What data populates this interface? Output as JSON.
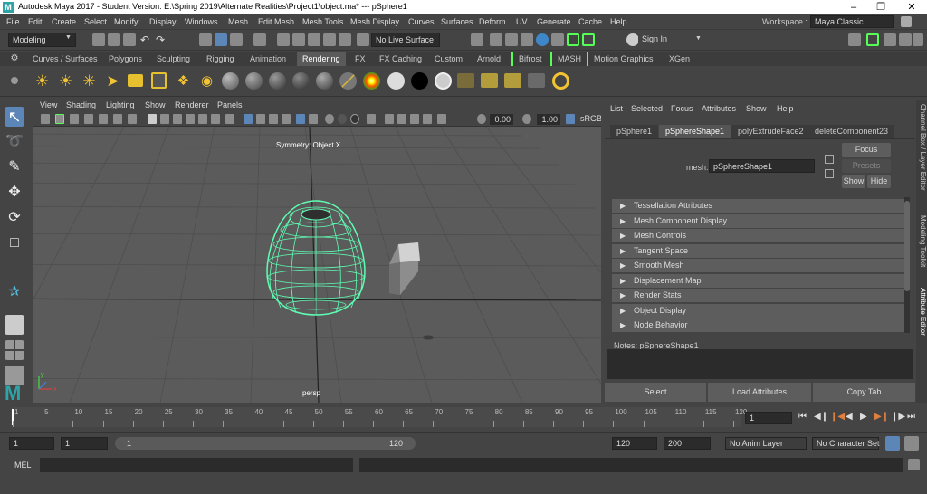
{
  "window": {
    "title": "Autodesk Maya 2017 - Student Version: E:\\Spring 2019\\Alternate Realities\\Project1\\object.ma*  ---  pSphere1",
    "logo": "M"
  },
  "menubar": [
    "File",
    "Edit",
    "Create",
    "Select",
    "Modify",
    "Display",
    "Windows",
    "Mesh",
    "Edit Mesh",
    "Mesh Tools",
    "Mesh Display",
    "Curves",
    "Surfaces",
    "Deform",
    "UV",
    "Generate",
    "Cache",
    "Help"
  ],
  "workspace": {
    "label": "Workspace :",
    "value": "Maya Classic"
  },
  "status_line": {
    "mode": "Modeling",
    "live_surface": "No Live Surface",
    "sign_in": "Sign In"
  },
  "shelf_tabs": [
    {
      "label": "Curves / Surfaces"
    },
    {
      "label": "Polygons"
    },
    {
      "label": "Sculpting"
    },
    {
      "label": "Rigging"
    },
    {
      "label": "Animation"
    },
    {
      "label": "Rendering",
      "active": true
    },
    {
      "label": "FX"
    },
    {
      "label": "FX Caching"
    },
    {
      "label": "Custom"
    },
    {
      "label": "Arnold"
    },
    {
      "label": "Bifrost"
    },
    {
      "label": "MASH"
    },
    {
      "label": "Motion Graphics"
    },
    {
      "label": "XGen"
    }
  ],
  "viewport": {
    "menus": [
      "View",
      "Shading",
      "Lighting",
      "Show",
      "Renderer",
      "Panels"
    ],
    "exposure": "0.00",
    "gamma": "1.00",
    "colorspace": "sRGB",
    "symmetry": "Symmetry: Object X",
    "camera": "persp",
    "axis_x": "x",
    "axis_y": "y",
    "accent": "#5effb4"
  },
  "attribute_editor": {
    "menus": [
      "List",
      "Selected",
      "Focus",
      "Attributes",
      "Show",
      "Help"
    ],
    "tabs": [
      {
        "label": "pSphere1"
      },
      {
        "label": "pSphereShape1",
        "active": true
      },
      {
        "label": "polyExtrudeFace2"
      },
      {
        "label": "deleteComponent23"
      }
    ],
    "mesh_label": "mesh:",
    "mesh_value": "pSphereShape1",
    "focus": "Focus",
    "presets": "Presets",
    "show": "Show",
    "hide": "Hide",
    "sections": [
      "Tessellation Attributes",
      "Mesh Component Display",
      "Mesh Controls",
      "Tangent Space",
      "Smooth Mesh",
      "Displacement Map",
      "Render Stats",
      "Object Display",
      "Node Behavior"
    ],
    "notes": "Notes:  pSphereShape1",
    "buttons": {
      "select": "Select",
      "load": "Load Attributes",
      "copy": "Copy Tab"
    }
  },
  "side_tabs": [
    "Channel Box / Layer Editor",
    "Modeling Toolkit",
    "Attribute Editor"
  ],
  "time_slider": {
    "ticks": [
      "1",
      "5",
      "10",
      "15",
      "20",
      "25",
      "30",
      "35",
      "40",
      "45",
      "50",
      "55",
      "60",
      "65",
      "70",
      "75",
      "80",
      "85",
      "90",
      "95",
      "100",
      "105",
      "110",
      "115",
      "120"
    ],
    "current": "1"
  },
  "range": {
    "start": "1",
    "playback_start": "1",
    "range_start": "1",
    "range_end": "120",
    "playback_end": "120",
    "end": "200",
    "anim_layer": "No Anim Layer",
    "char_set": "No Character Set"
  },
  "cmd": {
    "label": "MEL"
  }
}
